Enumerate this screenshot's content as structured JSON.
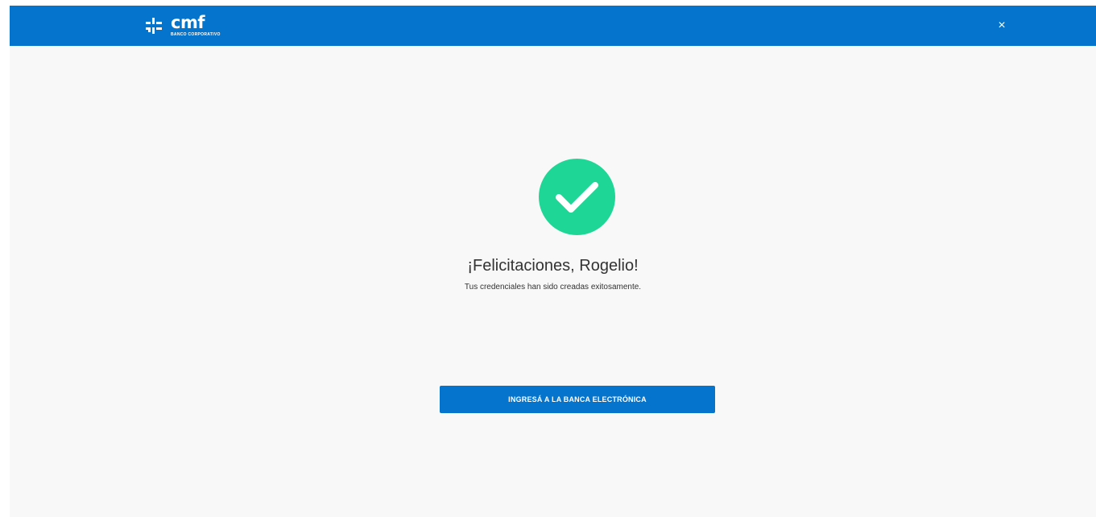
{
  "header": {
    "logo_word": "cmf",
    "logo_subtitle": "BANCO CORPORATIVO",
    "close_label": "×"
  },
  "main": {
    "title": "¡Felicitaciones, Rogelio!",
    "subtitle": "Tus credenciales han sido creadas exitosamente.",
    "cta_label": "INGRESÁ A LA BANCA ELECTRÓNICA"
  },
  "icons": {
    "logo": "cmf-logo-mark-icon",
    "close": "close-icon",
    "success": "check-circle-icon"
  },
  "colors": {
    "brand": "#0474cc",
    "success": "#1ed696",
    "background": "#f8f8f8",
    "text": "#333333"
  }
}
